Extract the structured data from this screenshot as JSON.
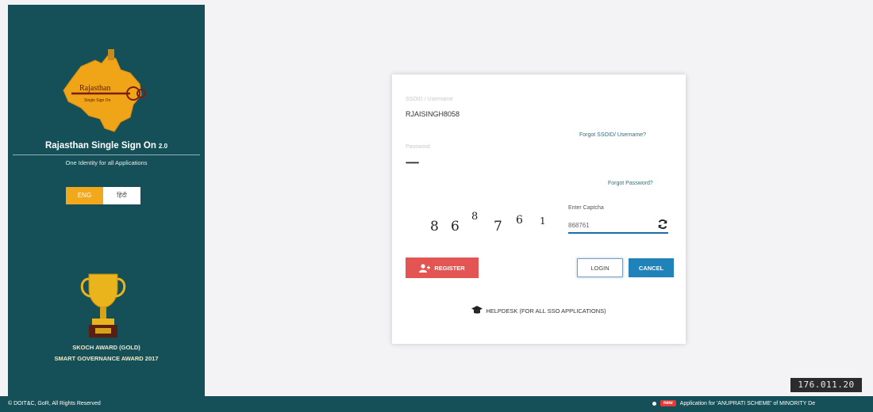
{
  "sidebar": {
    "logo_text": "Rajasthan",
    "logo_subtext": "Single Sign On",
    "title": "Rajasthan Single Sign On",
    "version": "2.0",
    "tagline": "One Identity for all Applications",
    "languages": [
      {
        "label": "ENG",
        "active": true
      },
      {
        "label": "हिंदी",
        "active": false
      }
    ],
    "award_line1": "SKOCH AWARD (GOLD)",
    "award_line2": "SMART GOVERNANCE AWARD 2017"
  },
  "login": {
    "username_label": "SSOID / Username",
    "username_value": "RJAISINGH8058",
    "forgot_username": "Forgot SSOID/ Username?",
    "password_label": "Password",
    "password_value": "•••••••••",
    "forgot_password": "Forgot Password?",
    "captcha_digits": [
      "8",
      "6",
      "8",
      "7",
      "6",
      "1"
    ],
    "captcha_label": "Enter Captcha",
    "captcha_value": "868761",
    "register_label": "REGISTER",
    "login_label": "LOGIN",
    "cancel_label": "CANCEL",
    "helpdesk_label": "HELPDESK (FOR ALL SSO APPLICATIONS)"
  },
  "footer": {
    "copyright": "© DOIT&C, GoR, All Rights Reserved",
    "new_badge": "new",
    "ticker": "Application for 'ANUPRATI SCHEME' of MINORITY De"
  },
  "overlay": {
    "ip_text": "176.011.20"
  },
  "colors": {
    "sidebar": "#155058",
    "accent_orange": "#f1a81b",
    "register_red": "#e35553",
    "cancel_blue": "#1f82b8"
  },
  "icons": [
    "rajasthan-map-logo-icon",
    "trophy-icon",
    "refresh-icon",
    "user-add-icon",
    "graduation-cap-icon"
  ]
}
